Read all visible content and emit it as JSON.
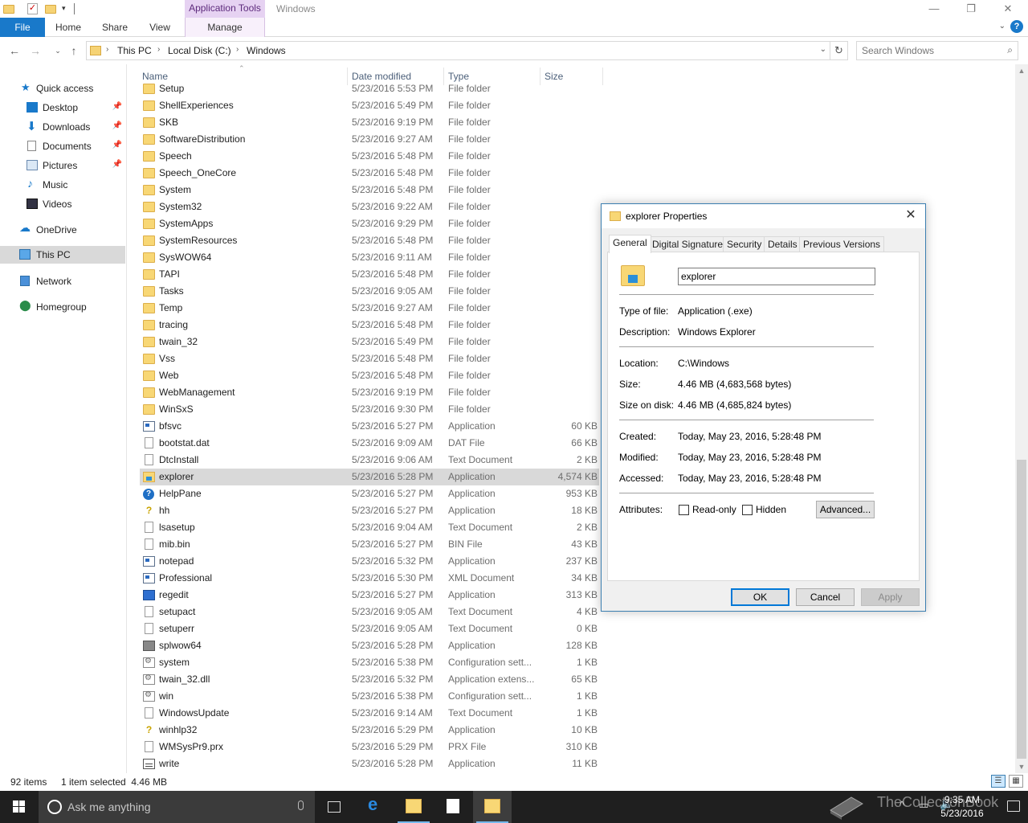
{
  "window": {
    "title": "Windows",
    "context_tab_group": "Application Tools",
    "controls": {
      "minimize": "—",
      "maximize": "❐",
      "close": "✕"
    }
  },
  "ribbon": {
    "tabs": [
      {
        "label": "File"
      },
      {
        "label": "Home"
      },
      {
        "label": "Share"
      },
      {
        "label": "View"
      },
      {
        "label": "Manage"
      }
    ]
  },
  "address": {
    "crumbs": [
      "This PC",
      "Local Disk (C:)",
      "Windows"
    ],
    "search_placeholder": "Search Windows"
  },
  "nav": {
    "items": [
      {
        "label": "Quick access",
        "icon": "star-icon",
        "pinned": false
      },
      {
        "label": "Desktop",
        "icon": "desktop-icon",
        "pinned": true
      },
      {
        "label": "Downloads",
        "icon": "download-icon",
        "pinned": true
      },
      {
        "label": "Documents",
        "icon": "documents-icon",
        "pinned": true
      },
      {
        "label": "Pictures",
        "icon": "pictures-icon",
        "pinned": true
      },
      {
        "label": "Music",
        "icon": "music-icon",
        "pinned": false
      },
      {
        "label": "Videos",
        "icon": "videos-icon",
        "pinned": false
      },
      {
        "label": "OneDrive",
        "icon": "cloud-icon",
        "pinned": false
      },
      {
        "label": "This PC",
        "icon": "computer-icon",
        "pinned": false,
        "selected": true
      },
      {
        "label": "Network",
        "icon": "network-icon",
        "pinned": false
      },
      {
        "label": "Homegroup",
        "icon": "homegroup-icon",
        "pinned": false
      }
    ]
  },
  "columns": {
    "name": "Name",
    "date": "Date modified",
    "type": "Type",
    "size": "Size"
  },
  "files": [
    {
      "name": "Setup",
      "date": "5/23/2016 5:53 PM",
      "type": "File folder",
      "size": "",
      "icon": "folder"
    },
    {
      "name": "ShellExperiences",
      "date": "5/23/2016 5:49 PM",
      "type": "File folder",
      "size": "",
      "icon": "folder"
    },
    {
      "name": "SKB",
      "date": "5/23/2016 9:19 PM",
      "type": "File folder",
      "size": "",
      "icon": "folder"
    },
    {
      "name": "SoftwareDistribution",
      "date": "5/23/2016 9:27 AM",
      "type": "File folder",
      "size": "",
      "icon": "folder"
    },
    {
      "name": "Speech",
      "date": "5/23/2016 5:48 PM",
      "type": "File folder",
      "size": "",
      "icon": "folder"
    },
    {
      "name": "Speech_OneCore",
      "date": "5/23/2016 5:48 PM",
      "type": "File folder",
      "size": "",
      "icon": "folder"
    },
    {
      "name": "System",
      "date": "5/23/2016 5:48 PM",
      "type": "File folder",
      "size": "",
      "icon": "folder"
    },
    {
      "name": "System32",
      "date": "5/23/2016 9:22 AM",
      "type": "File folder",
      "size": "",
      "icon": "folder"
    },
    {
      "name": "SystemApps",
      "date": "5/23/2016 9:29 PM",
      "type": "File folder",
      "size": "",
      "icon": "folder"
    },
    {
      "name": "SystemResources",
      "date": "5/23/2016 5:48 PM",
      "type": "File folder",
      "size": "",
      "icon": "folder"
    },
    {
      "name": "SysWOW64",
      "date": "5/23/2016 9:11 AM",
      "type": "File folder",
      "size": "",
      "icon": "folder"
    },
    {
      "name": "TAPI",
      "date": "5/23/2016 5:48 PM",
      "type": "File folder",
      "size": "",
      "icon": "folder"
    },
    {
      "name": "Tasks",
      "date": "5/23/2016 9:05 AM",
      "type": "File folder",
      "size": "",
      "icon": "folder"
    },
    {
      "name": "Temp",
      "date": "5/23/2016 9:27 AM",
      "type": "File folder",
      "size": "",
      "icon": "folder"
    },
    {
      "name": "tracing",
      "date": "5/23/2016 5:48 PM",
      "type": "File folder",
      "size": "",
      "icon": "folder"
    },
    {
      "name": "twain_32",
      "date": "5/23/2016 5:49 PM",
      "type": "File folder",
      "size": "",
      "icon": "folder"
    },
    {
      "name": "Vss",
      "date": "5/23/2016 5:48 PM",
      "type": "File folder",
      "size": "",
      "icon": "folder"
    },
    {
      "name": "Web",
      "date": "5/23/2016 5:48 PM",
      "type": "File folder",
      "size": "",
      "icon": "folder"
    },
    {
      "name": "WebManagement",
      "date": "5/23/2016 9:19 PM",
      "type": "File folder",
      "size": "",
      "icon": "folder"
    },
    {
      "name": "WinSxS",
      "date": "5/23/2016 9:30 PM",
      "type": "File folder",
      "size": "",
      "icon": "folder"
    },
    {
      "name": "bfsvc",
      "date": "5/23/2016 5:27 PM",
      "type": "Application",
      "size": "60 KB",
      "icon": "app"
    },
    {
      "name": "bootstat.dat",
      "date": "5/23/2016 9:09 AM",
      "type": "DAT File",
      "size": "66 KB",
      "icon": "file"
    },
    {
      "name": "DtcInstall",
      "date": "5/23/2016 9:06 AM",
      "type": "Text Document",
      "size": "2 KB",
      "icon": "file"
    },
    {
      "name": "explorer",
      "date": "5/23/2016 5:28 PM",
      "type": "Application",
      "size": "4,574 KB",
      "icon": "explorer",
      "selected": true
    },
    {
      "name": "HelpPane",
      "date": "5/23/2016 5:27 PM",
      "type": "Application",
      "size": "953 KB",
      "icon": "help"
    },
    {
      "name": "hh",
      "date": "5/23/2016 5:27 PM",
      "type": "Application",
      "size": "18 KB",
      "icon": "hh"
    },
    {
      "name": "lsasetup",
      "date": "5/23/2016 9:04 AM",
      "type": "Text Document",
      "size": "2 KB",
      "icon": "file"
    },
    {
      "name": "mib.bin",
      "date": "5/23/2016 5:27 PM",
      "type": "BIN File",
      "size": "43 KB",
      "icon": "file"
    },
    {
      "name": "notepad",
      "date": "5/23/2016 5:32 PM",
      "type": "Application",
      "size": "237 KB",
      "icon": "app"
    },
    {
      "name": "Professional",
      "date": "5/23/2016 5:30 PM",
      "type": "XML Document",
      "size": "34 KB",
      "icon": "app"
    },
    {
      "name": "regedit",
      "date": "5/23/2016 5:27 PM",
      "type": "Application",
      "size": "313 KB",
      "icon": "reg"
    },
    {
      "name": "setupact",
      "date": "5/23/2016 9:05 AM",
      "type": "Text Document",
      "size": "4 KB",
      "icon": "file"
    },
    {
      "name": "setuperr",
      "date": "5/23/2016 9:05 AM",
      "type": "Text Document",
      "size": "0 KB",
      "icon": "file"
    },
    {
      "name": "splwow64",
      "date": "5/23/2016 5:28 PM",
      "type": "Application",
      "size": "128 KB",
      "icon": "print"
    },
    {
      "name": "system",
      "date": "5/23/2016 5:38 PM",
      "type": "Configuration sett...",
      "size": "1 KB",
      "icon": "cfg"
    },
    {
      "name": "twain_32.dll",
      "date": "5/23/2016 5:32 PM",
      "type": "Application extens...",
      "size": "65 KB",
      "icon": "cfg"
    },
    {
      "name": "win",
      "date": "5/23/2016 5:38 PM",
      "type": "Configuration sett...",
      "size": "1 KB",
      "icon": "cfg"
    },
    {
      "name": "WindowsUpdate",
      "date": "5/23/2016 9:14 AM",
      "type": "Text Document",
      "size": "1 KB",
      "icon": "file"
    },
    {
      "name": "winhlp32",
      "date": "5/23/2016 5:29 PM",
      "type": "Application",
      "size": "10 KB",
      "icon": "hh"
    },
    {
      "name": "WMSysPr9.prx",
      "date": "5/23/2016 5:29 PM",
      "type": "PRX File",
      "size": "310 KB",
      "icon": "file"
    },
    {
      "name": "write",
      "date": "5/23/2016 5:28 PM",
      "type": "Application",
      "size": "11 KB",
      "icon": "write"
    }
  ],
  "status": {
    "item_count": "92 items",
    "selection": "1 item selected  4.46 MB"
  },
  "dialog": {
    "title": "explorer Properties",
    "tabs": [
      "General",
      "Digital Signatures",
      "Security",
      "Details",
      "Previous Versions"
    ],
    "active_tab": "General",
    "name_value": "explorer",
    "type_label": "Type of file:",
    "type_value": "Application (.exe)",
    "desc_label": "Description:",
    "desc_value": "Windows Explorer",
    "location_label": "Location:",
    "location_value": "C:\\Windows",
    "size_label": "Size:",
    "size_value": "4.46 MB (4,683,568 bytes)",
    "sizeondisk_label": "Size on disk:",
    "sizeondisk_value": "4.46 MB (4,685,824 bytes)",
    "created_label": "Created:",
    "created_value": "Today, May 23, 2016, 5:28:48 PM",
    "modified_label": "Modified:",
    "modified_value": "Today, May 23, 2016, 5:28:48 PM",
    "accessed_label": "Accessed:",
    "accessed_value": "Today, May 23, 2016, 5:28:48 PM",
    "attributes_label": "Attributes:",
    "readonly_label": "Read-only",
    "hidden_label": "Hidden",
    "advanced_label": "Advanced...",
    "ok_label": "OK",
    "cancel_label": "Cancel",
    "apply_label": "Apply"
  },
  "taskbar": {
    "cortana_text": "Ask me anything",
    "time": "9:35 AM",
    "date": "5/23/2016",
    "watermark": "TheCollectionBook"
  }
}
